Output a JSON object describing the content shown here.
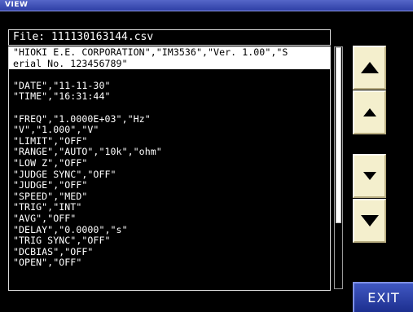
{
  "window": {
    "title": "VIEW"
  },
  "file": {
    "label": "File: 111130163144.csv"
  },
  "lines": [
    "\"HIOKI E.E. CORPORATION\",\"IM3536\",\"Ver. 1.00\",\"S",
    "erial No. 123456789\"",
    "",
    "\"DATE\",\"11-11-30\"",
    "\"TIME\",\"16:31:44\"",
    "",
    "\"FREQ\",\"1.0000E+03\",\"Hz\"",
    "\"V\",\"1.000\",\"V\"",
    "\"LIMIT\",\"OFF\"",
    "\"RANGE\",\"AUTO\",\"10k\",\"ohm\"",
    "\"LOW Z\",\"OFF\"",
    "\"JUDGE SYNC\",\"OFF\"",
    "\"JUDGE\",\"OFF\"",
    "\"SPEED\",\"MED\"",
    "\"TRIG\",\"INT\"",
    "\"AVG\",\"OFF\"",
    "\"DELAY\",\"0.0000\",\"s\"",
    "\"TRIG SYNC\",\"OFF\"",
    "\"DCBIAS\",\"OFF\"",
    "\"OPEN\",\"OFF\""
  ],
  "buttons": {
    "page_up_icon": "triangle-up-large-icon",
    "line_up_icon": "triangle-up-small-icon",
    "line_down_icon": "triangle-down-small-icon",
    "page_down_icon": "triangle-down-large-icon",
    "exit_label": "EXIT"
  },
  "colors": {
    "background": "#000000",
    "button_face": "#f4efcd",
    "exit_button": "#2a3fb0",
    "title_bar": "#3f50b8"
  }
}
